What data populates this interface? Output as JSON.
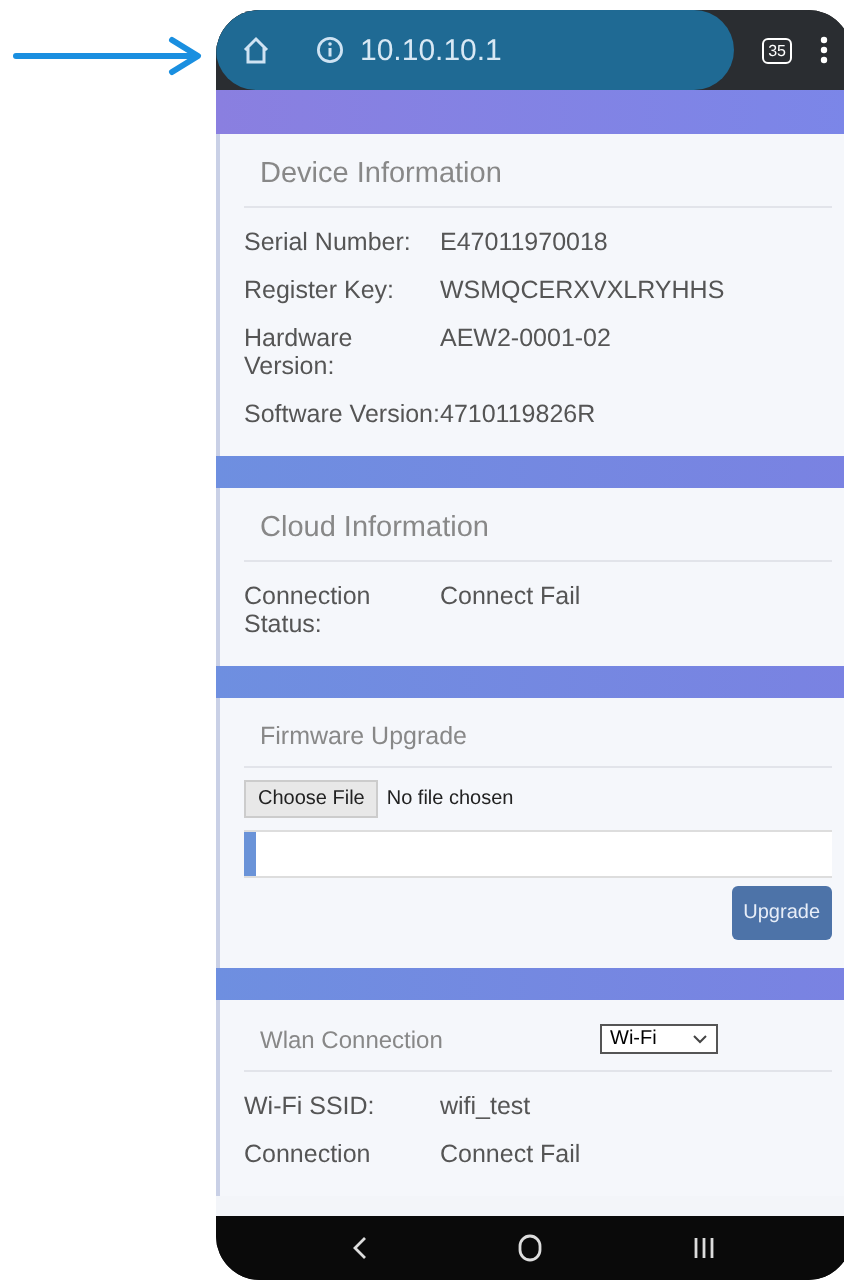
{
  "browser": {
    "url": "10.10.10.1",
    "tab_count": "35"
  },
  "sections": [
    {
      "kind": "info",
      "title": "Device Information",
      "rows": [
        {
          "label": "Serial Number:",
          "value": "E47011970018"
        },
        {
          "label": "Register Key:",
          "value": "WSMQCERXVXLRYHHS"
        },
        {
          "label": "Hardware Version:",
          "value": "AEW2-0001-02"
        },
        {
          "label": "Software Version:",
          "value": "4710119826R"
        }
      ]
    },
    {
      "kind": "info",
      "title": "Cloud Information",
      "rows": [
        {
          "label": "Connection Status:",
          "value": "Connect Fail"
        }
      ]
    },
    {
      "kind": "upgrade",
      "title": "Firmware Upgrade",
      "file_button": "Choose File",
      "file_status": "No file chosen",
      "level": 0.02,
      "button": "Upgrade"
    },
    {
      "kind": "wlan",
      "title": "Wlan Connection",
      "select": "Wi-Fi",
      "rows": [
        {
          "label": "Wi-Fi SSID:",
          "value": "wifi_test"
        },
        {
          "label": "Connection",
          "value": "Connect Fail"
        }
      ]
    }
  ]
}
